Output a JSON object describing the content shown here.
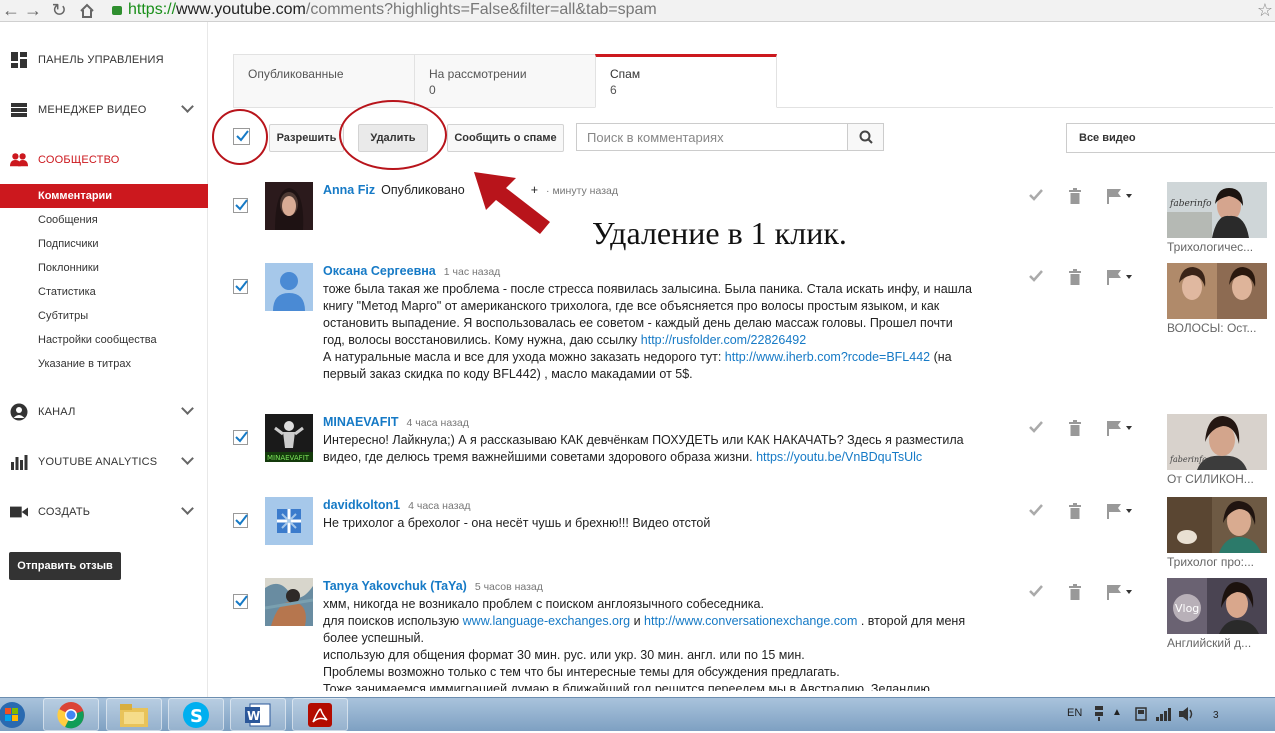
{
  "browser": {
    "url_scheme": "https://",
    "url_host": "www.youtube.com",
    "url_path": "/comments?highlights=False&filter=all&tab=spam"
  },
  "sidebar": {
    "dashboard": "ПАНЕЛЬ УПРАВЛЕНИЯ",
    "video_manager": "МЕНЕДЖЕР ВИДЕО",
    "community": "СООБЩЕСТВО",
    "community_items": [
      "Комментарии",
      "Сообщения",
      "Подписчики",
      "Поклонники",
      "Статистика",
      "Субтитры",
      "Настройки сообщества",
      "Указание в титрах"
    ],
    "channel": "КАНАЛ",
    "analytics": "YOUTUBE ANALYTICS",
    "create": "СОЗДАТЬ",
    "feedback": "Отправить отзыв"
  },
  "tabs": [
    {
      "label": "Опубликованные",
      "count": ""
    },
    {
      "label": "На рассмотрении",
      "count": "0"
    },
    {
      "label": "Спам",
      "count": "6"
    }
  ],
  "toolbar": {
    "approve": "Разрешить",
    "delete": "Удалить",
    "report": "Сообщить о спаме",
    "search_placeholder": "Поиск в комментариях",
    "video_filter": "Все видео"
  },
  "overlay": {
    "caption": "Удаление в 1 клик."
  },
  "comments": [
    {
      "author": "Anna Fiz",
      "time": "минуту назад",
      "published": "Опубликовано",
      "published_suffix": "+",
      "text": [],
      "video_title": "Трихологичес..."
    },
    {
      "author": "Оксана Сергеевна",
      "time": "1 час назад",
      "text": [
        "тоже была такая же проблема - после стресса появилась залысина. Была паника. Стала искать инфу, и  нашла",
        " книгу \"Метод Марго\" от американского трихолога, где все объясняется про волосы простым языком, и как",
        "остановить выпадение. Я воспользовалась ее советом - каждый день делаю массаж головы. Прошел почти",
        "год, волосы восстановились. Кому нужна, даю ссылку "
      ],
      "link1": "http://rusfolder.com/22826492",
      "line5": "А натуральные масла и все для ухода можно заказать недорого тут: ",
      "link2": "http://www.iherb.com?rcode=BFL442",
      "line5_end": " (на",
      "line6": "первый заказ скидка по коду  BFL442) , масло макадамии от 5$.",
      "video_title": "ВОЛОСЫ: Ост..."
    },
    {
      "author": "MINAEVAFIT",
      "time": "4 часа назад",
      "line1": "Интересно! Лайкнула;) А я рассказываю КАК девчёнкам ПОХУДЕТЬ или КАК НАКАЧАТЬ? Здесь я разместила",
      "line2": "видео, где делюсь тремя важнейшими советами здорового образа жизни. ",
      "link": "https://youtu.be/VnBDquTsUlc",
      "avatar_text": "MINAEVAFIT",
      "video_title": "От СИЛИКОН..."
    },
    {
      "author": "davidkolton1",
      "time": "4 часа назад",
      "line1": "Не трихолог а брехолог  - она несёт чушь и брехню!!! Видео отстой",
      "video_title": "Трихолог про:..."
    },
    {
      "author": "Tanya Yakovchuk (TaYa)",
      "time": "5 часов назад",
      "line1": "хмм, никогда не возникало проблем с поиском англоязычного собеседника.",
      "line2a": "для поисков использую ",
      "link1": "www.language-exchanges.org",
      "line2b": " и ",
      "link2": "http://www.conversationexchange.com",
      "line2c": " . второй для меня",
      "line3": "более успешный.",
      "line4": "использую для общения формат 30 мин. рус. или укр. 30 мин. англ. или по 15 мин.",
      "line5": "Проблемы возможно только с тем что бы интересные темы для обсуждения предлагать.",
      "line6": "Тоже занимаемся иммиграцией думаю в ближайший год решится переедем мы в Австралию. Зеландию",
      "thumb_text": "Vlog",
      "video_title": "Английский д..."
    }
  ],
  "thumb_brand": "faberinfo",
  "taskbar": {
    "lang": "EN",
    "clock_fragment": "3"
  },
  "colors": {
    "accent": "#cc181e",
    "link": "#167ac6",
    "taskbar": "#8fb0d0"
  }
}
